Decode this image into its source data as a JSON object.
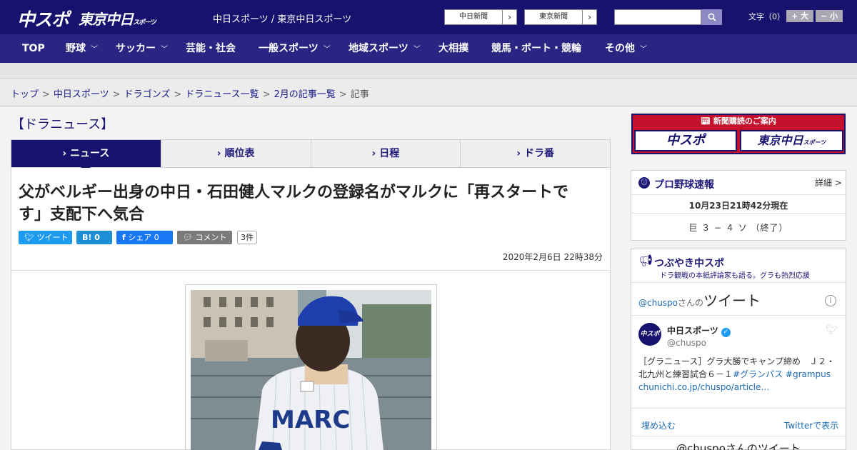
{
  "header": {
    "logo_main": "中スポ",
    "logo_tokyo": "東京中日",
    "logo_tokyo_sub": "スポーツ",
    "site_title": "中日スポーツ / 東京中日スポーツ",
    "papers": [
      "中日新聞",
      "東京新聞"
    ],
    "font_size_label": "文字（0）",
    "font_plus": "+ 大",
    "font_minus": "− 小"
  },
  "nav": [
    {
      "label": "TOP",
      "dropdown": false
    },
    {
      "label": "野球",
      "dropdown": true
    },
    {
      "label": "サッカー",
      "dropdown": true
    },
    {
      "label": "芸能・社会",
      "dropdown": false
    },
    {
      "label": "一般スポーツ",
      "dropdown": true
    },
    {
      "label": "地域スポーツ",
      "dropdown": true
    },
    {
      "label": "大相撲",
      "dropdown": false
    },
    {
      "label": "競馬・ボート・競輪",
      "dropdown": false
    },
    {
      "label": "その他",
      "dropdown": true
    }
  ],
  "breadcrumb": [
    "トップ",
    "中日スポーツ",
    "ドラゴンズ",
    "ドラニュース一覧",
    "2月の記事一覧",
    "記事"
  ],
  "section_title": "【ドラニュース】",
  "tabs": [
    "ニュース",
    "順位表",
    "日程",
    "ドラ番"
  ],
  "article": {
    "headline": "父がベルギー出身の中日・石田健人マルクの登録名がマルクに「再スタートです」支配下へ気合",
    "share": {
      "tweet": "ツイート",
      "hatena": "B! 0",
      "facebook": "シェア 0",
      "comment": "コメント",
      "comment_count": "3件"
    },
    "date": "2020年2月6日 22時38分",
    "photo_jersey_text": "MARC"
  },
  "sidebar": {
    "ad_title": "新聞購読のご案内",
    "ad_logo_1": "中スポ",
    "ad_logo_2": "東京中日",
    "ad_logo_2_sub": "スポーツ",
    "baseball": {
      "title": "プロ野球速報",
      "more": "詳細 >",
      "time": "10月23日21時42分現在",
      "score": "巨 ３ − ４ ソ （終了）"
    },
    "tweets": {
      "title": "つぶやき中スポ",
      "subtitle": "ドラ観戦の本紙評論家も語る。グラも熱烈応援",
      "handle_prefix": "@chuspo",
      "handle_suffix": "さんの",
      "heading": "ツイート",
      "account_name": "中日スポーツ",
      "account_handle": "@chuspo",
      "avatar_text": "中スポ",
      "text_1": "［グラニュース］グラ大勝でキャンプ締め　Ｊ２・北九州と練習試合６－１",
      "hashtag_1": "#グランパス",
      "hashtag_2": "#grampus",
      "link": "chunichi.co.jp/chuspo/article…",
      "embed": "埋め込む",
      "view_on_twitter": "Twitterで表示",
      "footer": "@chuspoさんのツイート"
    }
  },
  "colors": {
    "header": "#17126e",
    "nav": "#2a2482",
    "twitter": "#1d9bf0",
    "facebook": "#1877f2",
    "ad_red": "#c4122c"
  }
}
